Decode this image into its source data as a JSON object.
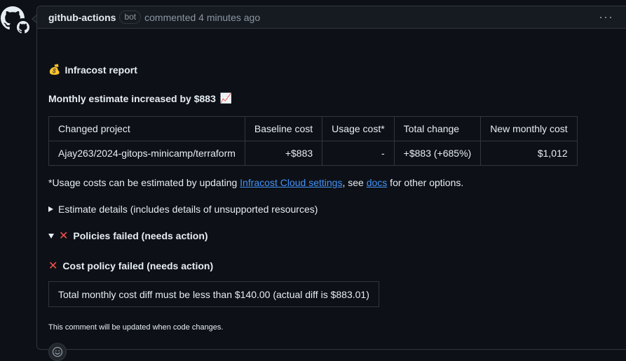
{
  "comment": {
    "author": "github-actions",
    "badge": "bot",
    "meta": "commented 4 minutes ago",
    "menu_icon": "kebab-horizontal-icon"
  },
  "report": {
    "title_emoji": "💰",
    "title": "Infracost report",
    "estimate_heading": "Monthly estimate increased by $883",
    "estimate_emoji": "📈",
    "table": {
      "headers": [
        "Changed project",
        "Baseline cost",
        "Usage cost*",
        "Total change",
        "New monthly cost"
      ],
      "rows": [
        [
          "Ajay263/2024-gitops-minicamp/terraform",
          "+$883",
          "-",
          "+$883 (+685%)",
          "$1,012"
        ]
      ]
    },
    "usage_note_prefix": "*Usage costs can be estimated by updating ",
    "usage_note_link1": "Infracost Cloud settings",
    "usage_note_middle": ", see ",
    "usage_note_link2": "docs",
    "usage_note_suffix": " for other options.",
    "estimate_details": "Estimate details (includes details of unsupported resources)",
    "policies_failed": "Policies failed (needs action)",
    "cost_policy_failed": "Cost policy failed (needs action)",
    "policy_message": "Total monthly cost diff must be less than $140.00 (actual diff is $883.01)",
    "footer_note": "This comment will be updated when code changes."
  },
  "colors": {
    "background": "#0d1117",
    "header": "#161b22",
    "border": "#30363d",
    "link": "#4493f8",
    "fail_x": "#f85149"
  }
}
